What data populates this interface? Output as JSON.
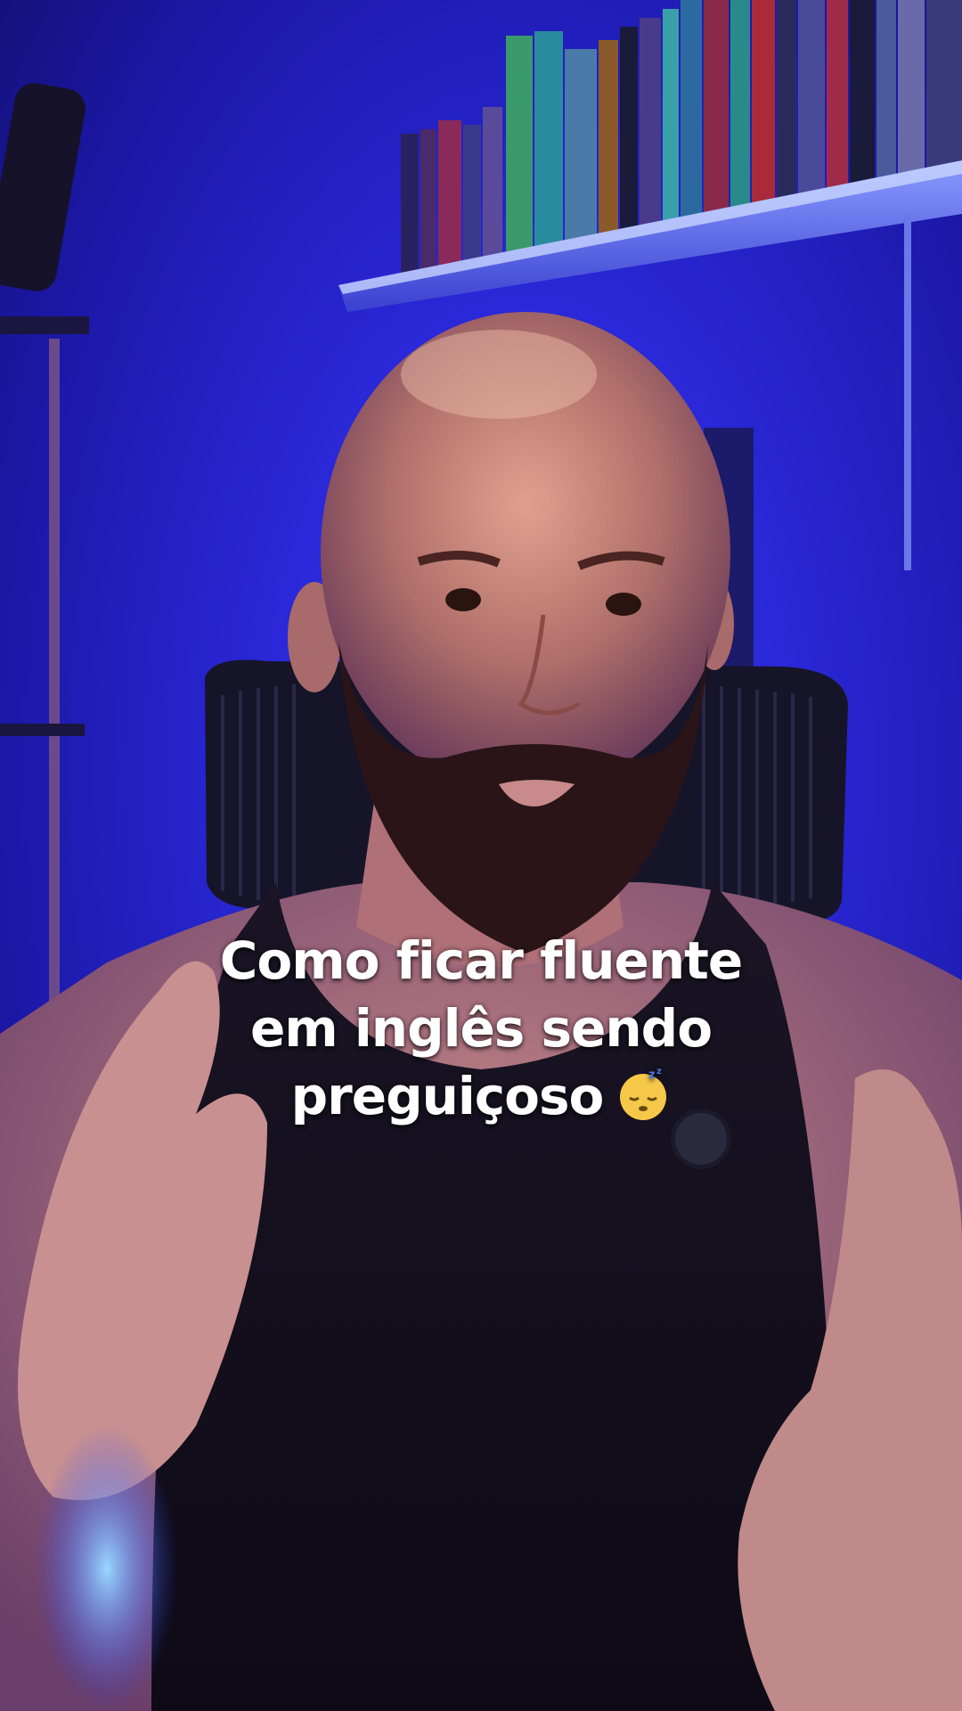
{
  "caption": {
    "line1": "Como ficar fluente",
    "line2": "em inglês sendo",
    "line3": "preguiçoso",
    "emoji": "sleeping-face"
  },
  "colors": {
    "background": "#2a28d8",
    "caption_text": "#ffffff"
  }
}
